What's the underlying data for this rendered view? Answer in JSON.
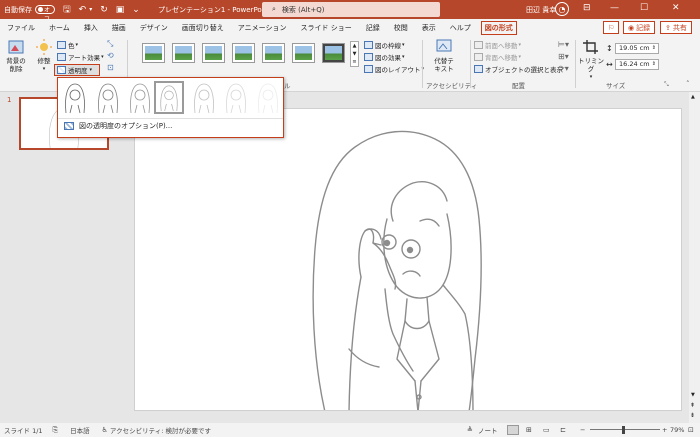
{
  "titlebar": {
    "autosave_label": "自動保存",
    "autosave_state": "オフ",
    "doc_title": "プレゼンテーション1 - PowerPoint",
    "search_placeholder": "検索 (Alt+Q)",
    "user_name": "田辺 貴幸"
  },
  "tabs": [
    "ファイル",
    "ホーム",
    "挿入",
    "描画",
    "デザイン",
    "画面切り替え",
    "アニメーション",
    "スライド ショー",
    "記録",
    "校閲",
    "表示",
    "ヘルプ"
  ],
  "active_tab": "図の形式",
  "right_buttons": {
    "record": "記録",
    "share": "共有"
  },
  "ribbon": {
    "remove_bg": "背景の\n削除",
    "corrections": "修整",
    "color": "色",
    "art_effects": "アート効果",
    "transparency": "透明度",
    "picture_border": "図の枠線",
    "picture_effects": "図の効果",
    "picture_layout": "図のレイアウト",
    "alt_text": "代替テ\nキスト",
    "accessibility": "アクセシビリティ",
    "bring_forward": "前面へ移動",
    "send_backward": "背面へ移動",
    "selection_pane": "オブジェクトの選択と表示",
    "arrange": "配置",
    "crop": "トリミング",
    "height": "19.05 cm",
    "width": "16.24 cm",
    "size": "サイズ",
    "styles_label": "ル"
  },
  "popup": {
    "option": "図の透明度のオプション(P)..."
  },
  "slide_number": "1",
  "status": {
    "slide": "スライド 1/1",
    "lang": "日本語",
    "accessibility": "アクセシビリティ: 検討が必要です",
    "notes": "ノート",
    "zoom": "79%"
  },
  "colors": {
    "accent": "#b7472a",
    "highlight": "#c43e1c"
  }
}
